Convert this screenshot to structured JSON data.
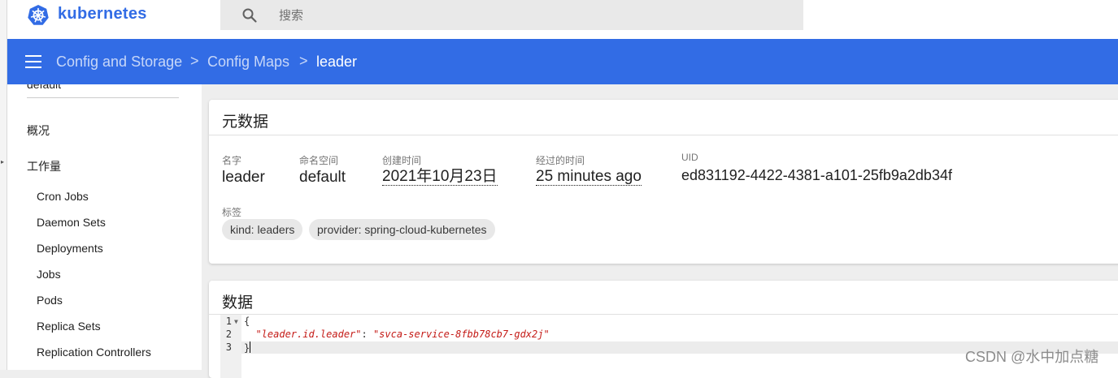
{
  "header": {
    "brand": "kubernetes",
    "search_placeholder": "搜索"
  },
  "breadcrumb": {
    "items": [
      "Config and Storage",
      "Config Maps",
      "leader"
    ],
    "separator": ">"
  },
  "sidebar": {
    "namespace": "default",
    "items": [
      {
        "label": "概况"
      },
      {
        "label": "工作量"
      },
      {
        "label": "Cron Jobs"
      },
      {
        "label": "Daemon Sets"
      },
      {
        "label": "Deployments"
      },
      {
        "label": "Jobs"
      },
      {
        "label": "Pods"
      },
      {
        "label": "Replica Sets"
      },
      {
        "label": "Replication Controllers"
      }
    ]
  },
  "metadata": {
    "title": "元数据",
    "fields": [
      {
        "label": "名字",
        "value": "leader"
      },
      {
        "label": "命名空间",
        "value": "default"
      },
      {
        "label": "创建时间",
        "value": "2021年10月23日"
      },
      {
        "label": "经过的时间",
        "value": "25 minutes ago"
      },
      {
        "label": "UID",
        "value": "ed831192-4422-4381-a101-25fb9a2db34f"
      }
    ],
    "labels_title": "标签",
    "labels": [
      "kind: leaders",
      "provider: spring-cloud-kubernetes"
    ]
  },
  "data_section": {
    "title": "数据",
    "line_numbers": [
      "1",
      "2",
      "3"
    ],
    "open_brace": "{",
    "key": "\"leader.id.leader\"",
    "colon": ": ",
    "value": "\"svca-service-8fbb78cb7-gdx2j\"",
    "close_brace": "}"
  },
  "watermark": "CSDN @水中加点糖",
  "colors": {
    "primary": "#326ce5",
    "background": "#eeeeee",
    "chip": "#e8e8e8"
  }
}
